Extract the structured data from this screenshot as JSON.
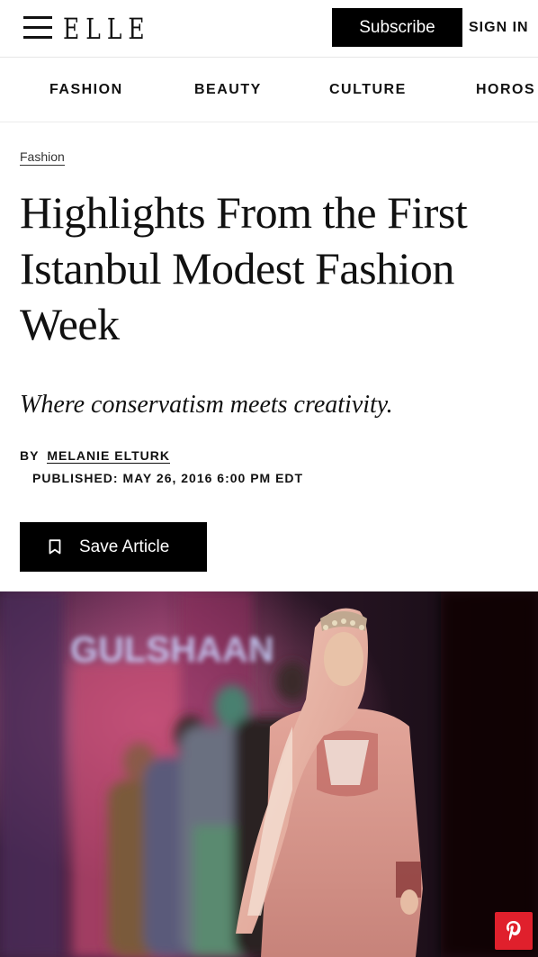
{
  "header": {
    "logo_text": "ELLE",
    "subscribe_label": "Subscribe",
    "signin_label": "SIGN IN"
  },
  "nav": {
    "items": [
      {
        "label": "FASHION"
      },
      {
        "label": "BEAUTY"
      },
      {
        "label": "CULTURE"
      },
      {
        "label": "HOROS"
      }
    ]
  },
  "article": {
    "category": "Fashion",
    "headline": "Highlights From the First Istanbul Modest Fashion Week",
    "dek": "Where conservatism meets creativity.",
    "byline_prefix": "BY",
    "author": "MELANIE ELTURK",
    "published": "PUBLISHED: MAY 26, 2016 6:00 PM EDT",
    "save_label": "Save Article"
  },
  "hero": {
    "backdrop_text": "GULSHAAN"
  },
  "icons": {
    "menu": "hamburger-menu-icon",
    "bookmark": "bookmark-icon",
    "pinterest": "pinterest-icon"
  },
  "colors": {
    "brand_black": "#000000",
    "pinterest_red": "#e0202c",
    "dress_pink": "#d99a8c"
  }
}
